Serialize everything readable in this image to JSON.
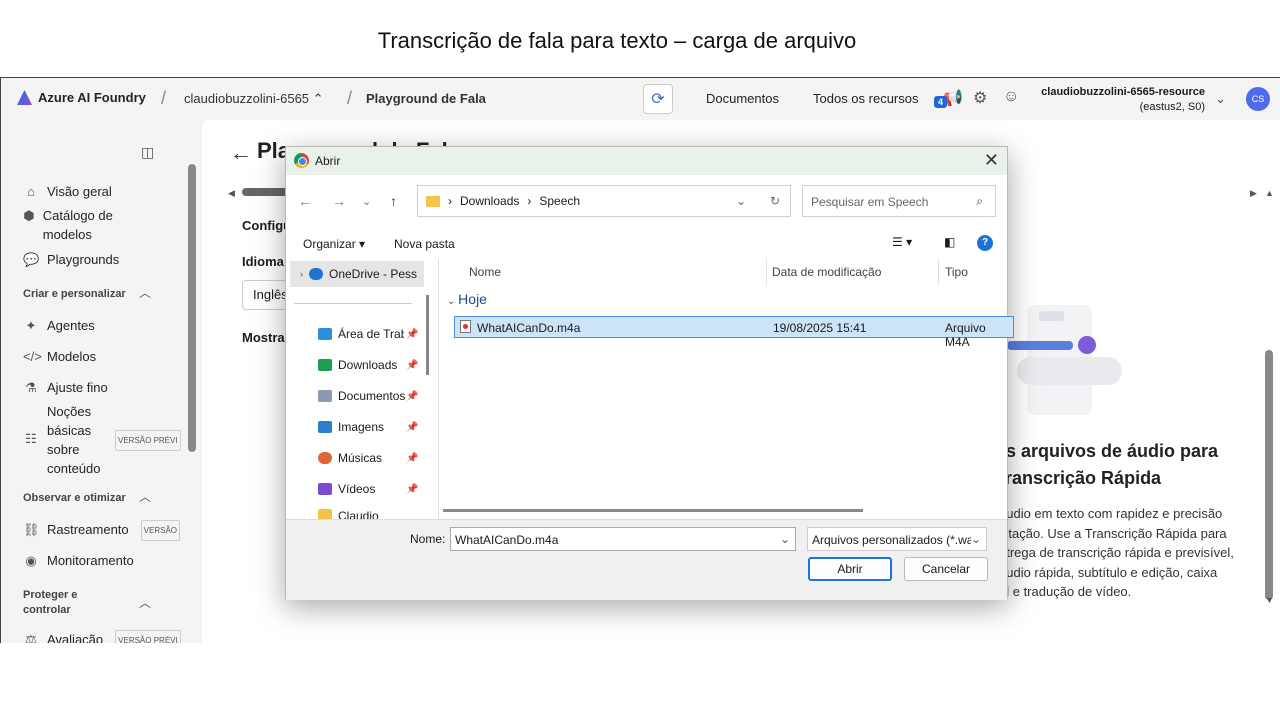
{
  "slide_title": "Transcrição de fala para texto – carga de arquivo",
  "topbar": {
    "brand": "Azure AI Foundry",
    "project": "claudiobuzzolini-6565",
    "page": "Playground de Fala",
    "documents": "Documentos",
    "all_resources": "Todos os recursos",
    "notif_count": "4",
    "resource_name": "claudiobuzzolini-6565-resource",
    "resource_region": "(eastus2, S0)",
    "avatar": "CS"
  },
  "sidebar": {
    "items": [
      {
        "label": "Visão geral",
        "icon": "home-icon"
      },
      {
        "label": "Catálogo de modelos",
        "icon": "cube-icon"
      },
      {
        "label": "Playgrounds",
        "icon": "chat-icon"
      }
    ],
    "section_create": "Criar e personalizar",
    "create_items": [
      {
        "label": "Agentes",
        "icon": "agent-icon"
      },
      {
        "label": "Modelos",
        "icon": "code-icon"
      },
      {
        "label": "Ajuste fino",
        "icon": "flask-icon"
      },
      {
        "label": "Noções básicas sobre conteúdo",
        "icon": "content-icon",
        "tag": "VERSÃO PRÉVI"
      }
    ],
    "section_observe": "Observar e otimizar",
    "observe_items": [
      {
        "label": "Rastreamento",
        "icon": "trace-icon",
        "tag": "VERSÃO"
      },
      {
        "label": "Monitoramento",
        "icon": "monitor-icon"
      }
    ],
    "section_protect": "Proteger e controlar",
    "protect_items": [
      {
        "label": "Avaliação",
        "icon": "scale-icon",
        "tag": "VERSÃO PRÉVI"
      }
    ]
  },
  "main": {
    "title": "Playground de Fala",
    "config": "Configu",
    "idioma": "Idioma",
    "lang_value": "Inglês",
    "mostra": "Mostra",
    "panel_title_1": "os arquivos de áudio para",
    "panel_title_2": "Transcrição Rápida",
    "panel_desc": [
      "áudio em texto com rapidez e precisão",
      "citação. Use a Transcrição Rápida para",
      "ntrega de transcrição rápida e previsível,",
      "áudio rápida, subtítulo e edição, caixa",
      "al e tradução de vídeo."
    ]
  },
  "dialog": {
    "title": "Abrir",
    "path": [
      "Downloads",
      "Speech"
    ],
    "search_placeholder": "Pesquisar em Speech",
    "organize": "Organizar",
    "new_folder": "Nova pasta",
    "nav_items": [
      {
        "label": "OneDrive - Pess",
        "icon": "cloud-icon",
        "color": "#1e74d4"
      },
      {
        "label": "Área de Trab",
        "icon": "desktop-icon",
        "color": "#2a8fd6"
      },
      {
        "label": "Downloads",
        "icon": "download-icon",
        "color": "#1f9d55"
      },
      {
        "label": "Documentos",
        "icon": "document-icon",
        "color": "#8a9bb0"
      },
      {
        "label": "Imagens",
        "icon": "image-icon",
        "color": "#2a7fd0"
      },
      {
        "label": "Músicas",
        "icon": "music-icon",
        "color": "#e0663a"
      },
      {
        "label": "Vídeos",
        "icon": "video-icon",
        "color": "#7a4bd6"
      },
      {
        "label": "Claudio",
        "icon": "folder-icon",
        "color": "#f2c54a"
      }
    ],
    "columns": [
      "Nome",
      "Data de modificação",
      "Tipo"
    ],
    "group": "Hoje",
    "files": [
      {
        "name": "WhatAICanDo.m4a",
        "date": "19/08/2025 15:41",
        "type": "Arquivo M4A"
      }
    ],
    "name_label": "Nome:",
    "name_value": "WhatAICanDo.m4a",
    "type_value": "Arquivos personalizados (*.wav",
    "open": "Abrir",
    "cancel": "Cancelar"
  }
}
